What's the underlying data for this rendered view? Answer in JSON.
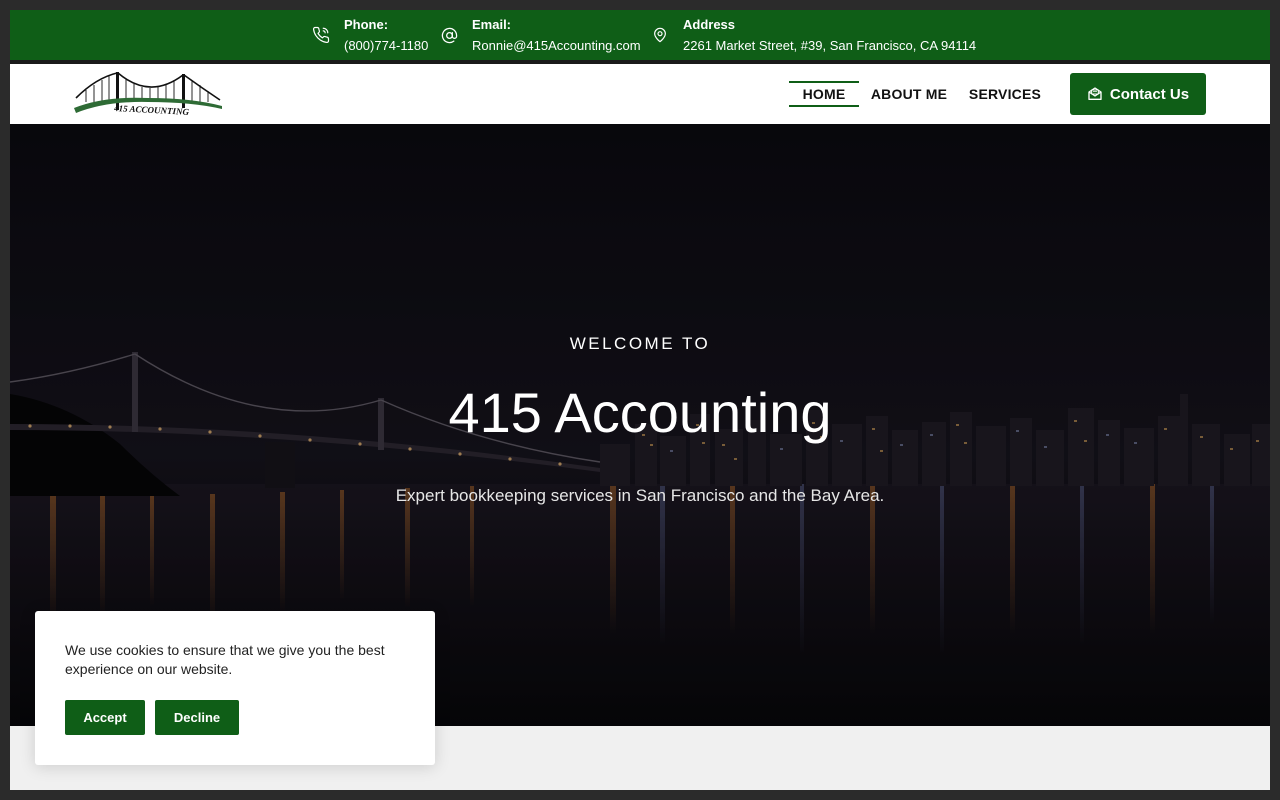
{
  "topbar": {
    "phone": {
      "label": "Phone:",
      "value": "(800)774-1180"
    },
    "email": {
      "label": "Email:",
      "value": "Ronnie@415Accounting.com"
    },
    "address": {
      "label": "Address",
      "value": "2261 Market Street, #39, San Francisco, CA 94114"
    }
  },
  "header": {
    "logo_text": "415 ACCOUNTING",
    "nav": [
      {
        "label": "HOME",
        "active": true
      },
      {
        "label": "ABOUT ME",
        "active": false
      },
      {
        "label": "SERVICES",
        "active": false
      }
    ],
    "contact_label": "Contact Us"
  },
  "hero": {
    "welcome": "WELCOME TO",
    "title": "415 Accounting",
    "subtitle": "Expert bookkeeping services in San Francisco and the Bay Area."
  },
  "cookie": {
    "message": "We use cookies to ensure that we give you the best experience on our website.",
    "accept_label": "Accept",
    "decline_label": "Decline"
  },
  "colors": {
    "brand_green": "#0f5e17",
    "topbar_bg": "#0f5e17"
  },
  "icons": {
    "phone": "phone-icon",
    "email": "at-sign-icon",
    "address": "map-pin-icon",
    "contact": "envelope-open-icon"
  }
}
